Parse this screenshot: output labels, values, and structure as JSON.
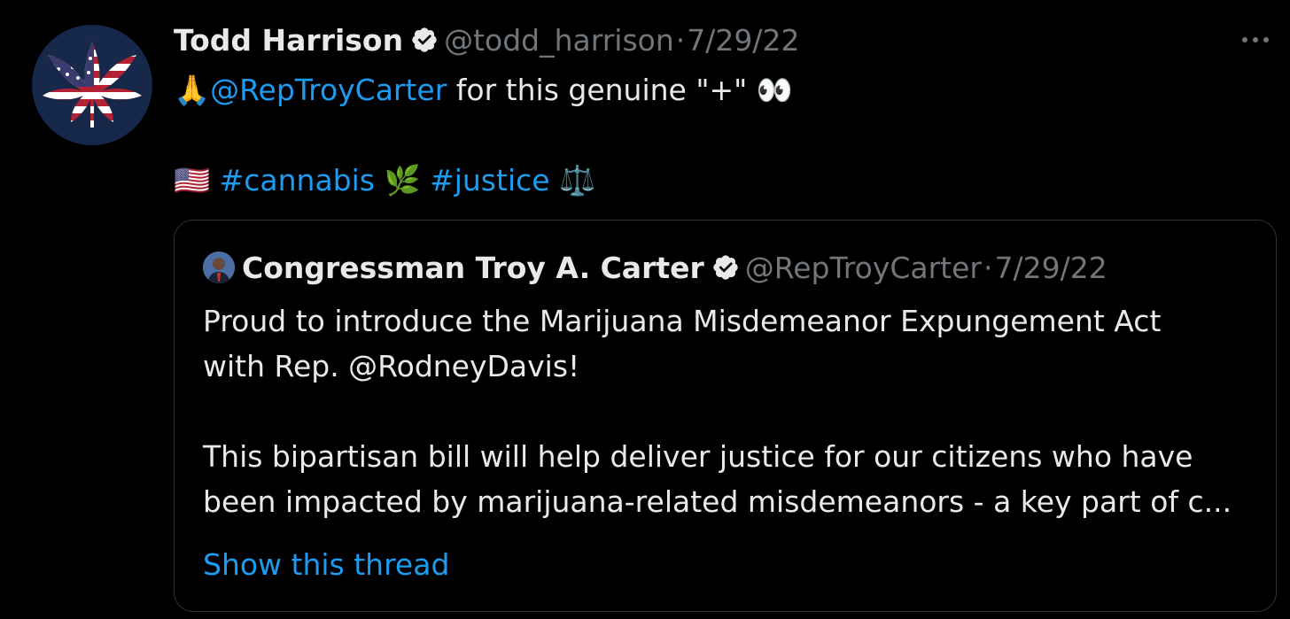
{
  "tweet": {
    "author_name": "Todd Harrison",
    "author_handle": "@todd_harrison",
    "separator": "·",
    "date": "7/29/22",
    "more_label": "···",
    "line1": {
      "emoji1": "🙏",
      "mention": "@RepTroyCarter",
      "text": " for this genuine \"+\" ",
      "emoji2": "👀"
    },
    "line2": {
      "emoji1": "🇺🇸",
      "hashtag1": "#cannabis",
      "emoji2": "🌿",
      "hashtag2": "#justice",
      "emoji3": "⚖️"
    }
  },
  "quote": {
    "author_name": "Congressman Troy A. Carter",
    "author_handle": "@RepTroyCarter",
    "separator": "·",
    "date": "7/29/22",
    "paragraph1_line1": "Proud to introduce the Marijuana Misdemeanor Expungement Act",
    "paragraph1_line2": "with Rep. @RodneyDavis!",
    "paragraph2_line1": "This bipartisan bill will help deliver justice for our citizens who have",
    "paragraph2_line2": "been impacted by marijuana-related misdemeanors - a key part of c...",
    "show_thread": "Show this thread"
  },
  "colors": {
    "background": "#000000",
    "text": "#e7e9ea",
    "muted": "#71767b",
    "link": "#1d9bf0",
    "border": "#2f3336"
  },
  "icons": {
    "avatar": "cannabis-leaf-us-flag-avatar",
    "verified": "verified-badge-icon",
    "more": "more-horizontal-icon"
  }
}
